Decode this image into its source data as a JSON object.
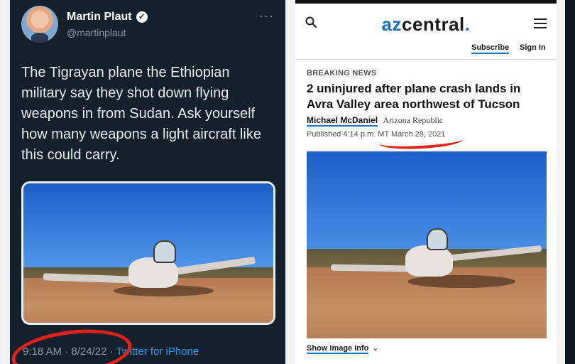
{
  "tweet": {
    "author_name": "Martin Plaut",
    "handle": "@martinplaut",
    "more_label": "···",
    "text": "The Tigrayan plane the Ethiopian military say they shot down flying weapons in from Sudan. Ask yourself how many weapons a light aircraft like this could carry.",
    "time": "9:18 AM",
    "date": "8/24/22",
    "separator": "·",
    "client": "Twitter for iPhone",
    "annotation_color": "#e0221b"
  },
  "article": {
    "logo_prefix": "az",
    "logo_rest": "central",
    "logo_dot": ".",
    "subscribe_label": "Subscribe",
    "signin_label": "Sign In",
    "kicker": "BREAKING NEWS",
    "headline": "2 uninjured after plane crash lands in Avra Valley area northwest of Tucson",
    "author": "Michael McDaniel",
    "outlet": "Arizona Republic",
    "published": "Published 4:14 p.m. MT March 28, 2021",
    "show_image_info_label": "Show image info",
    "accent_color": "#1b72c0"
  },
  "icons": {
    "search": "search-icon",
    "menu": "hamburger-menu-icon",
    "verified": "verified-badge-icon",
    "chevron": "chevron-down-icon"
  }
}
